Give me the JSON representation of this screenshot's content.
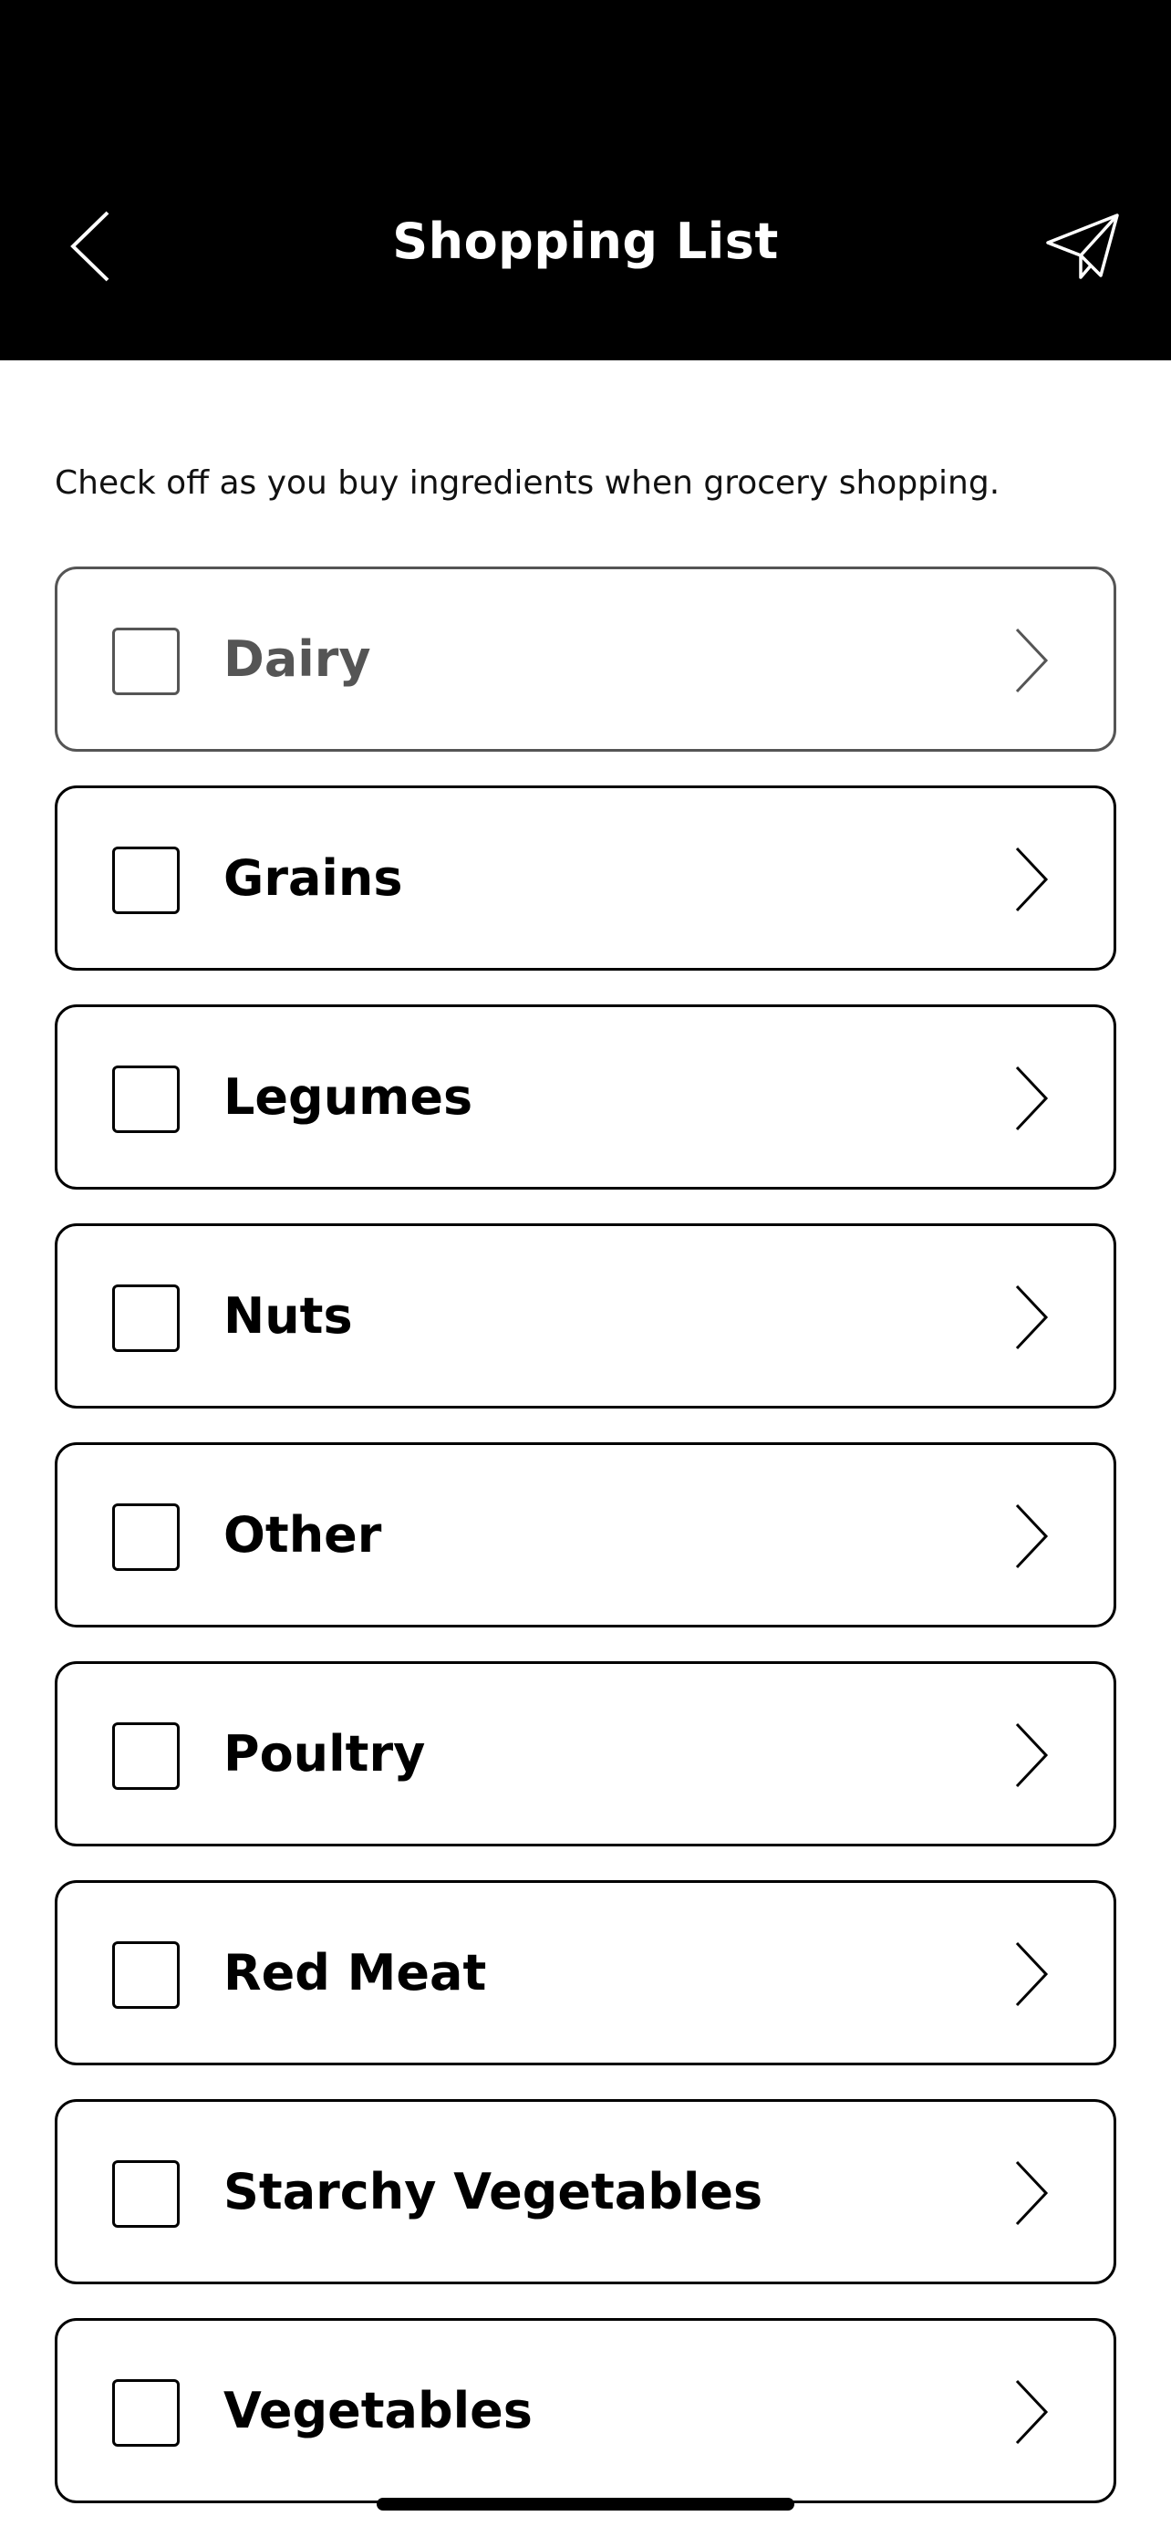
{
  "header": {
    "title": "Shopping List",
    "back_icon": "chevron-left-icon",
    "share_icon": "paper-plane-icon",
    "background": "#000000"
  },
  "intro": {
    "text": "Check off as you buy ingredients when grocery shopping."
  },
  "categories": [
    {
      "label": "Dairy",
      "checked": false,
      "dimmed": true
    },
    {
      "label": "Grains",
      "checked": false,
      "dimmed": false
    },
    {
      "label": "Legumes",
      "checked": false,
      "dimmed": false
    },
    {
      "label": "Nuts",
      "checked": false,
      "dimmed": false
    },
    {
      "label": "Other",
      "checked": false,
      "dimmed": false
    },
    {
      "label": "Poultry",
      "checked": false,
      "dimmed": false
    },
    {
      "label": "Red Meat",
      "checked": false,
      "dimmed": false
    },
    {
      "label": "Starchy Vegetables",
      "checked": false,
      "dimmed": false
    },
    {
      "label": "Vegetables",
      "checked": false,
      "dimmed": false
    }
  ]
}
